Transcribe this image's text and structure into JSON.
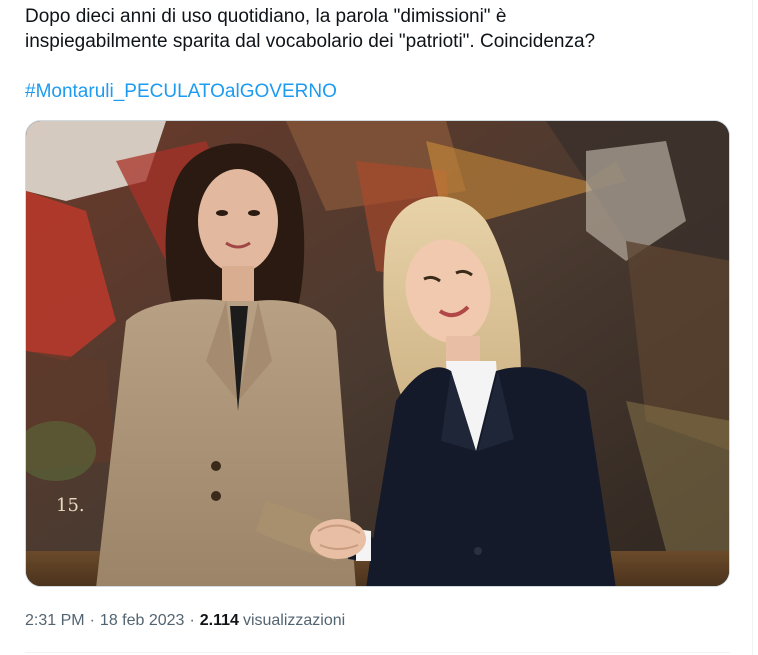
{
  "tweet": {
    "text_line1": "Dopo dieci anni di uso quotidiano, la parola \"dimissioni\" è",
    "text_line2": "inspiegabilmente sparita dal vocabolario dei \"patrioti\". Coincidenza?",
    "hashtag": "#Montaruli_PECULATOalGOVERNO",
    "photo_alt": "Immagine",
    "painting_number": "15.",
    "time": "2:31 PM",
    "date": "18 feb 2023",
    "separator": "·",
    "views_count": "2.114",
    "views_label": "visualizzazioni"
  },
  "colors": {
    "text": "#0f1419",
    "secondary": "#536471",
    "link": "#1d9bf0",
    "border": "#cfd9de"
  }
}
